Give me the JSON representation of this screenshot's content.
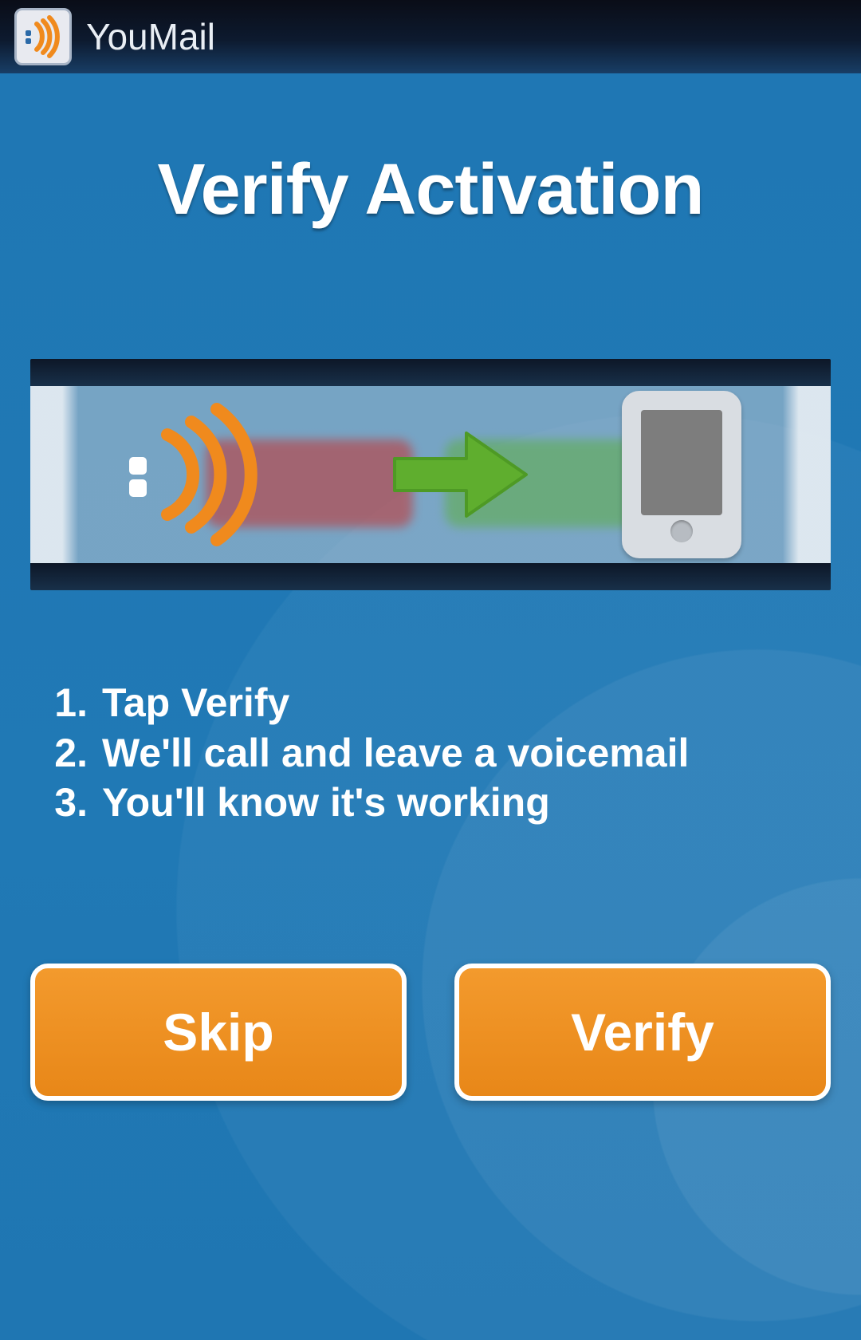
{
  "header": {
    "app_title": "YouMail"
  },
  "page": {
    "title": "Verify Activation"
  },
  "steps": [
    {
      "n": "1.",
      "text": "Tap Verify"
    },
    {
      "n": "2.",
      "text": "We'll call and leave a voicemail"
    },
    {
      "n": "3.",
      "text": "You'll know it's working"
    }
  ],
  "buttons": {
    "skip": "Skip",
    "verify": "Verify"
  },
  "colors": {
    "accent_orange": "#ee8e1f",
    "bg_blue": "#1f77b4"
  }
}
